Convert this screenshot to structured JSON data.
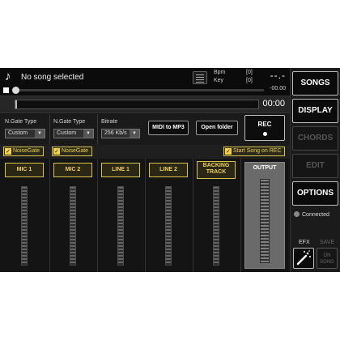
{
  "header": {
    "song_title": "No song selected",
    "bpm_label": "Bpm",
    "bpm_value": "[0]",
    "key_label": "Key",
    "key_value": "[0]",
    "time_display": "--.-",
    "time_remaining": "-00.00",
    "note_icon": "music-note-icon",
    "list_icon": "song-list-icon"
  },
  "transport": {
    "elapsed": "00:00",
    "progress": 0
  },
  "controls": {
    "ngate1_label": "N.Gate Type",
    "ngate1_value": "Custom",
    "ngate2_label": "N.Gate Type",
    "ngate2_value": "Custom",
    "bitrate_label": "Bitrate",
    "bitrate_value": "256 Kb/s",
    "midi_to_mp3": "MIDI to MP3",
    "open_folder": "Open folder",
    "rec": "REC"
  },
  "checks": {
    "noisegate1": "NoiseGate",
    "noisegate2": "NoiseGate",
    "start_song_on_rec": "Start Song on REC"
  },
  "channels": {
    "mic1": "MIC 1",
    "mic2": "MIC 2",
    "line1": "LINE 1",
    "line2": "LINE 2",
    "backing_line1": "BACKING",
    "backing_line2": "TRACK",
    "output": "OUTPUT"
  },
  "side": {
    "songs": "SONGS",
    "display": "DISPLAY",
    "chords": "CHORDS",
    "edit": "EDIT",
    "options": "OPTIONS",
    "connected": "Connected",
    "efx": "EFX",
    "save": "SAVE",
    "on_song_line1": "ON",
    "on_song_line2": "SONG"
  },
  "colors": {
    "accent": "#f2d24a",
    "background": "#151515"
  }
}
